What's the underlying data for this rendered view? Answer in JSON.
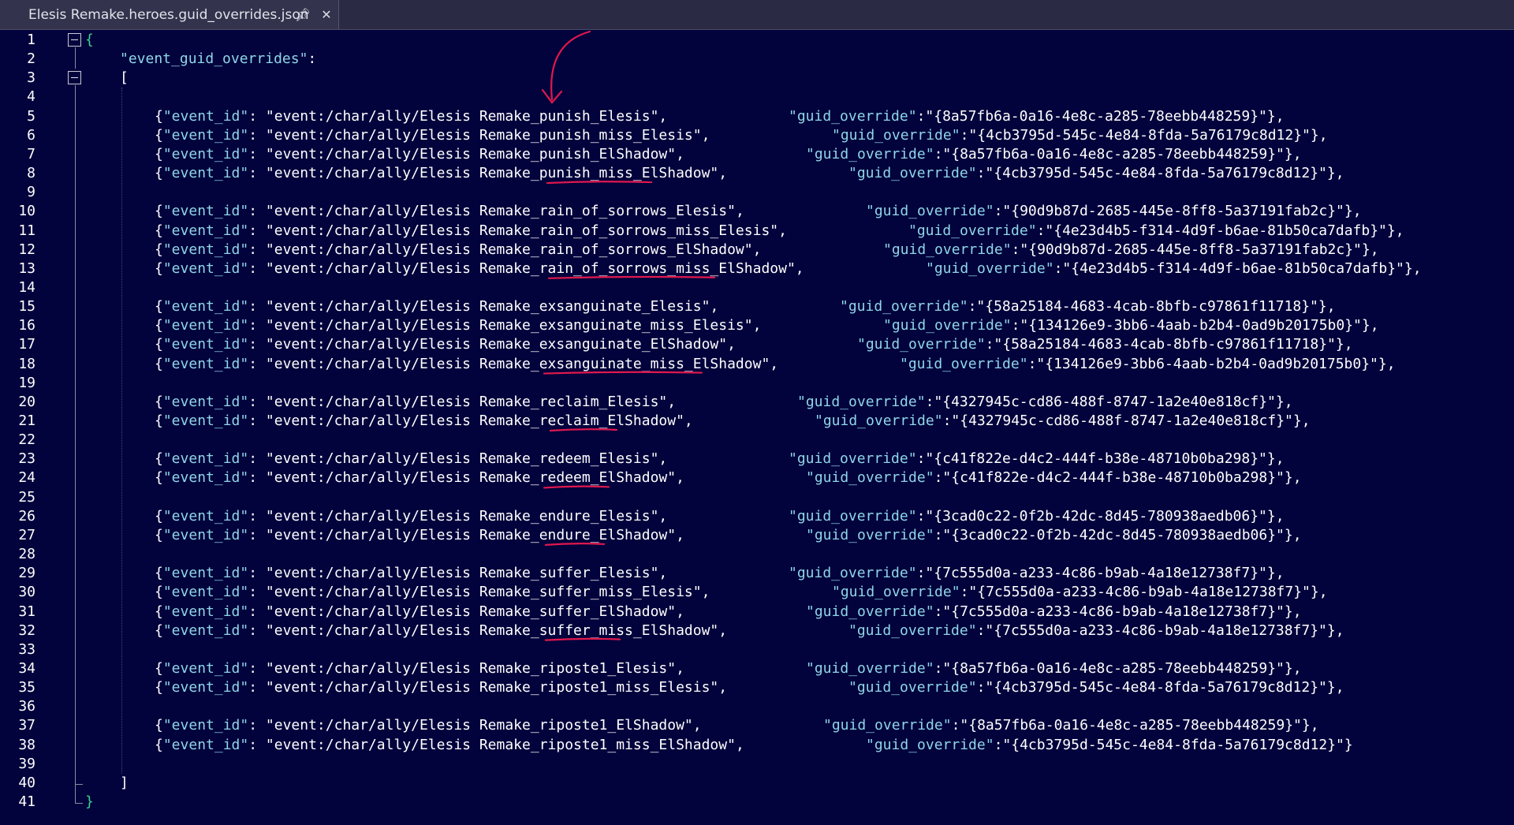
{
  "tab": {
    "title": "Elesis Remake.heroes.guid_overrides.json",
    "pin_icon": "pin-icon",
    "close_icon": "close-icon"
  },
  "lines": [
    {
      "n": "1",
      "text": "{"
    },
    {
      "n": "2",
      "key": "\"event_guid_overrides\"",
      "text": ":"
    },
    {
      "n": "3",
      "text": "["
    },
    {
      "n": "4",
      "text": ""
    },
    {
      "n": "5",
      "event": "\"event:/char/ally/Elesis Remake_punish_Elesis\"",
      "guid": "\"{8a57fb6a-0a16-4e8c-a285-78eebb448259}\"",
      "end": "},"
    },
    {
      "n": "6",
      "event": "\"event:/char/ally/Elesis Remake_punish_miss_Elesis\"",
      "guid": "\"{4cb3795d-545c-4e84-8fda-5a76179c8d12}\"",
      "end": "},"
    },
    {
      "n": "7",
      "event": "\"event:/char/ally/Elesis Remake_punish_ElShadow\"",
      "guid": "\"{8a57fb6a-0a16-4e8c-a285-78eebb448259}\"",
      "end": "},"
    },
    {
      "n": "8",
      "event": "\"event:/char/ally/Elesis Remake_punish_miss_ElShadow\"",
      "guid": "\"{4cb3795d-545c-4e84-8fda-5a76179c8d12}\"",
      "end": "},"
    },
    {
      "n": "9",
      "text": ""
    },
    {
      "n": "10",
      "event": "\"event:/char/ally/Elesis Remake_rain_of_sorrows_Elesis\"",
      "guid": "\"{90d9b87d-2685-445e-8ff8-5a37191fab2c}\"",
      "end": "},"
    },
    {
      "n": "11",
      "event": "\"event:/char/ally/Elesis Remake_rain_of_sorrows_miss_Elesis\"",
      "guid": "\"{4e23d4b5-f314-4d9f-b6ae-81b50ca7dafb}\"",
      "end": "},"
    },
    {
      "n": "12",
      "event": "\"event:/char/ally/Elesis Remake_rain_of_sorrows_ElShadow\"",
      "guid": "\"{90d9b87d-2685-445e-8ff8-5a37191fab2c}\"",
      "end": "},"
    },
    {
      "n": "13",
      "event": "\"event:/char/ally/Elesis Remake_rain_of_sorrows_miss_ElShadow\"",
      "guid": "\"{4e23d4b5-f314-4d9f-b6ae-81b50ca7dafb}\"",
      "end": "},"
    },
    {
      "n": "14",
      "text": ""
    },
    {
      "n": "15",
      "event": "\"event:/char/ally/Elesis Remake_exsanguinate_Elesis\"",
      "guid": "\"{58a25184-4683-4cab-8bfb-c97861f11718}\"",
      "end": "},"
    },
    {
      "n": "16",
      "event": "\"event:/char/ally/Elesis Remake_exsanguinate_miss_Elesis\"",
      "guid": "\"{134126e9-3bb6-4aab-b2b4-0ad9b20175b0}\"",
      "end": "},"
    },
    {
      "n": "17",
      "event": "\"event:/char/ally/Elesis Remake_exsanguinate_ElShadow\"",
      "guid": "\"{58a25184-4683-4cab-8bfb-c97861f11718}\"",
      "end": "},"
    },
    {
      "n": "18",
      "event": "\"event:/char/ally/Elesis Remake_exsanguinate_miss_ElShadow\"",
      "guid": "\"{134126e9-3bb6-4aab-b2b4-0ad9b20175b0}\"",
      "end": "},"
    },
    {
      "n": "19",
      "text": ""
    },
    {
      "n": "20",
      "event": "\"event:/char/ally/Elesis Remake_reclaim_Elesis\"",
      "guid": "\"{4327945c-cd86-488f-8747-1a2e40e818cf}\"",
      "end": "},"
    },
    {
      "n": "21",
      "event": "\"event:/char/ally/Elesis Remake_reclaim_ElShadow\"",
      "guid": "\"{4327945c-cd86-488f-8747-1a2e40e818cf}\"",
      "end": "},"
    },
    {
      "n": "22",
      "text": ""
    },
    {
      "n": "23",
      "event": "\"event:/char/ally/Elesis Remake_redeem_Elesis\"",
      "guid": "\"{c41f822e-d4c2-444f-b38e-48710b0ba298}\"",
      "end": "},"
    },
    {
      "n": "24",
      "event": "\"event:/char/ally/Elesis Remake_redeem_ElShadow\"",
      "guid": "\"{c41f822e-d4c2-444f-b38e-48710b0ba298}\"",
      "end": "},"
    },
    {
      "n": "25",
      "text": ""
    },
    {
      "n": "26",
      "event": "\"event:/char/ally/Elesis Remake_endure_Elesis\"",
      "guid": "\"{3cad0c22-0f2b-42dc-8d45-780938aedb06}\"",
      "end": "},"
    },
    {
      "n": "27",
      "event": "\"event:/char/ally/Elesis Remake_endure_ElShadow\"",
      "guid": "\"{3cad0c22-0f2b-42dc-8d45-780938aedb06}\"",
      "end": "},"
    },
    {
      "n": "28",
      "text": ""
    },
    {
      "n": "29",
      "event": "\"event:/char/ally/Elesis Remake_suffer_Elesis\"",
      "guid": "\"{7c555d0a-a233-4c86-b9ab-4a18e12738f7}\"",
      "end": "},"
    },
    {
      "n": "30",
      "event": "\"event:/char/ally/Elesis Remake_suffer_miss_Elesis\"",
      "guid": "\"{7c555d0a-a233-4c86-b9ab-4a18e12738f7}\"",
      "end": "},"
    },
    {
      "n": "31",
      "event": "\"event:/char/ally/Elesis Remake_suffer_ElShadow\"",
      "guid": "\"{7c555d0a-a233-4c86-b9ab-4a18e12738f7}\"",
      "end": "},"
    },
    {
      "n": "32",
      "event": "\"event:/char/ally/Elesis Remake_suffer_miss_ElShadow\"",
      "guid": "\"{7c555d0a-a233-4c86-b9ab-4a18e12738f7}\"",
      "end": "},"
    },
    {
      "n": "33",
      "text": ""
    },
    {
      "n": "34",
      "event": "\"event:/char/ally/Elesis Remake_riposte1_Elesis\"",
      "guid": "\"{8a57fb6a-0a16-4e8c-a285-78eebb448259}\"",
      "end": "},"
    },
    {
      "n": "35",
      "event": "\"event:/char/ally/Elesis Remake_riposte1_miss_Elesis\"",
      "guid": "\"{4cb3795d-545c-4e84-8fda-5a76179c8d12}\"",
      "end": "},"
    },
    {
      "n": "36",
      "text": ""
    },
    {
      "n": "37",
      "event": "\"event:/char/ally/Elesis Remake_riposte1_ElShadow\"",
      "guid": "\"{8a57fb6a-0a16-4e8c-a285-78eebb448259}\"",
      "end": "},"
    },
    {
      "n": "38",
      "event": "\"event:/char/ally/Elesis Remake_riposte1_miss_ElShadow\"",
      "guid": "\"{4cb3795d-545c-4e84-8fda-5a76179c8d12}\"",
      "end": "}"
    },
    {
      "n": "39",
      "text": ""
    },
    {
      "n": "40",
      "text": "]"
    },
    {
      "n": "41",
      "text": "}"
    }
  ],
  "json_tokens": {
    "event_key": "\"event_id\"",
    "guid_key": "\"guid_override\"",
    "open": "{",
    "colon": ": ",
    "comma": ",",
    "guid_colon": ":"
  },
  "colors": {
    "background": "#02023c",
    "key": "#8fd6e8",
    "string": "#ffffff",
    "brace": "#3fd18f",
    "annotation": "#e0184e"
  }
}
